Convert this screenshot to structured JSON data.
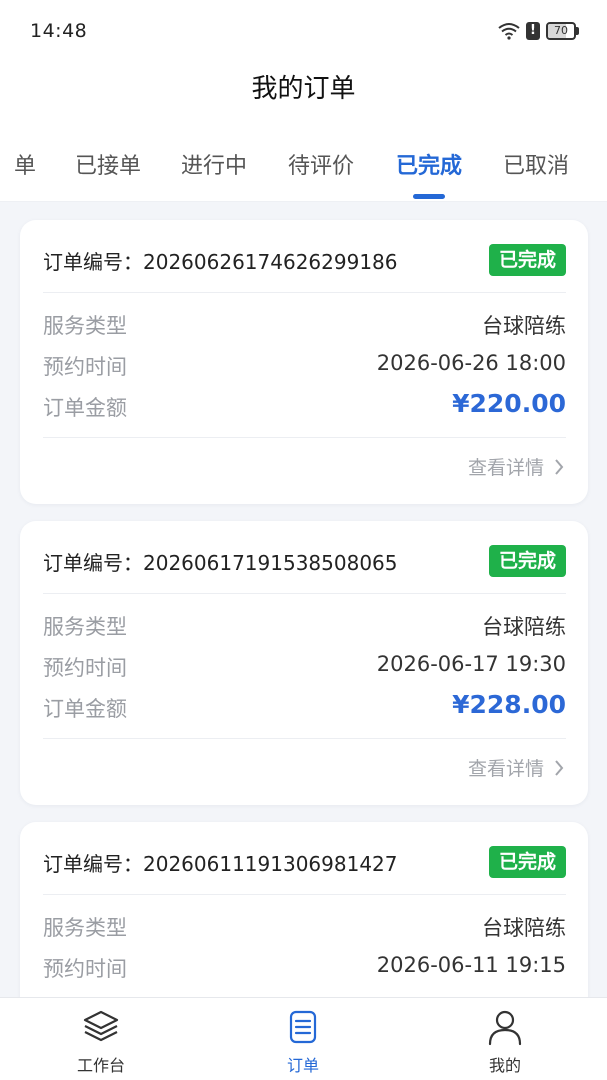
{
  "status_bar": {
    "time": "14:48",
    "battery": "70",
    "battery_level": 0.7
  },
  "header": {
    "title": "我的订单"
  },
  "tabs": [
    {
      "label": "单",
      "active": false
    },
    {
      "label": "已接单",
      "active": false
    },
    {
      "label": "进行中",
      "active": false
    },
    {
      "label": "待评价",
      "active": false
    },
    {
      "label": "已完成",
      "active": true
    },
    {
      "label": "已取消",
      "active": false
    }
  ],
  "orders": [
    {
      "order_no": "订单编号：20260626174626299186",
      "status": "已完成",
      "service_label": "服务类型",
      "service_value": "台球陪练",
      "time_label": "预约时间",
      "time_value": "2026-06-26 18:00",
      "amount_label": "订单金额",
      "amount_value": "¥220.00",
      "detail_label": "查看详情"
    },
    {
      "order_no": "订单编号：20260617191538508065",
      "status": "已完成",
      "service_label": "服务类型",
      "service_value": "台球陪练",
      "time_label": "预约时间",
      "time_value": "2026-06-17 19:30",
      "amount_label": "订单金额",
      "amount_value": "¥228.00",
      "detail_label": "查看详情"
    },
    {
      "order_no": "订单编号：20260611191306981427",
      "status": "已完成",
      "service_label": "服务类型",
      "service_value": "台球陪练",
      "time_label": "预约时间",
      "time_value": "2026-06-11 19:15"
    }
  ],
  "bottom_nav": [
    {
      "label": "工作台",
      "icon": "layers-icon",
      "active": false
    },
    {
      "label": "订单",
      "icon": "document-list-icon",
      "active": true
    },
    {
      "label": "我的",
      "icon": "user-icon",
      "active": false
    }
  ],
  "colors": {
    "accent": "#2468d6",
    "success": "#1fb14a",
    "amount": "#2c68d6"
  }
}
